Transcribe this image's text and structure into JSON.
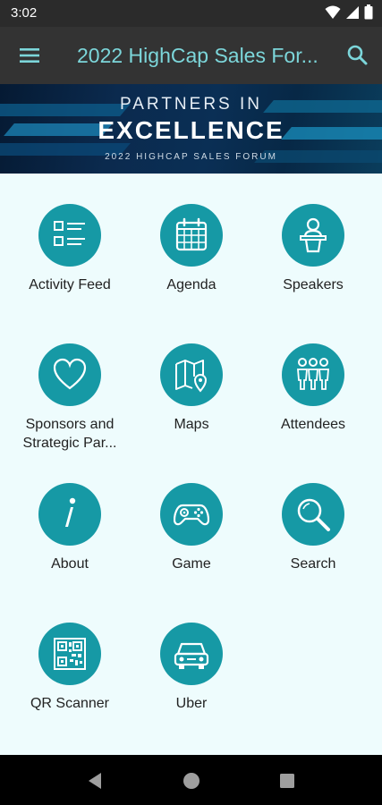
{
  "status_bar": {
    "time": "3:02"
  },
  "app_bar": {
    "title": "2022 HighCap Sales For..."
  },
  "banner": {
    "line1": "PARTNERS IN",
    "line2": "EXCELLENCE",
    "line3": "2022 HIGHCAP SALES FORUM"
  },
  "tiles": [
    {
      "label": "Activity Feed",
      "icon": "list-icon"
    },
    {
      "label": "Agenda",
      "icon": "calendar-icon"
    },
    {
      "label": "Speakers",
      "icon": "speaker-podium-icon"
    },
    {
      "label": "Sponsors and Strategic Par...",
      "icon": "heart-icon"
    },
    {
      "label": "Maps",
      "icon": "map-pin-icon"
    },
    {
      "label": "Attendees",
      "icon": "people-group-icon"
    },
    {
      "label": "About",
      "icon": "info-icon"
    },
    {
      "label": "Game",
      "icon": "gamepad-icon"
    },
    {
      "label": "Search",
      "icon": "magnifier-icon"
    },
    {
      "label": "QR Scanner",
      "icon": "qr-code-icon"
    },
    {
      "label": "Uber",
      "icon": "car-icon"
    }
  ],
  "colors": {
    "accent": "#1699a5",
    "title": "#7cd6da",
    "app_bar": "#333333",
    "background": "#eefcfd"
  }
}
